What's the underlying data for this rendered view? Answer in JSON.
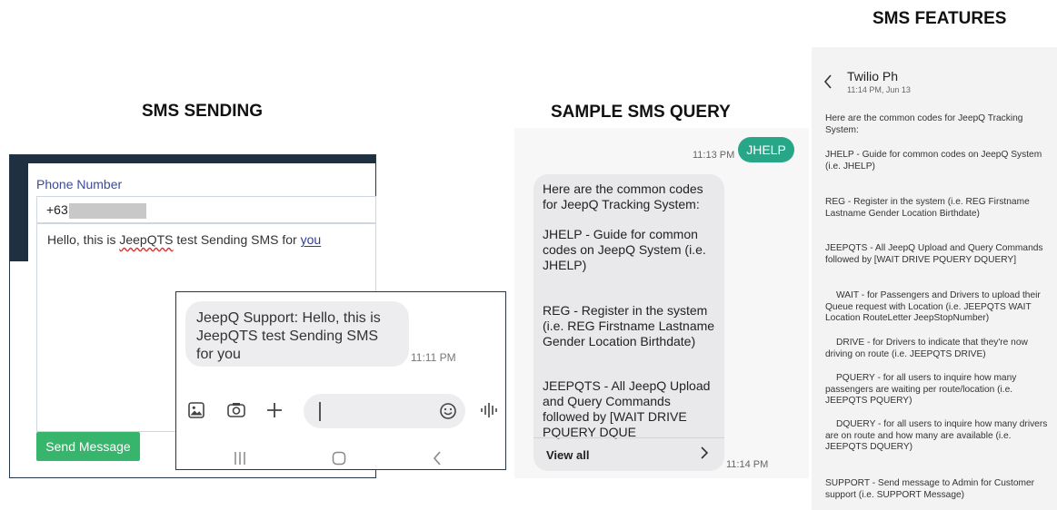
{
  "headings": {
    "sending": "SMS SENDING",
    "query": "SAMPLE SMS QUERY",
    "features": "SMS FEATURES"
  },
  "form": {
    "phone_label": "Phone Number",
    "phone_prefix": "+63",
    "message_part1": "Hello, this is ",
    "message_brand": "JeepQTS",
    "message_part2": " test Sending SMS for ",
    "message_you": "you",
    "send_button": "Send Message"
  },
  "chat": {
    "message": "JeepQ Support: Hello, this is JeepQTS test Sending SMS for you",
    "time": "11:11 PM",
    "icons": [
      "gallery-icon",
      "camera-icon",
      "plus-icon",
      "emoji-icon",
      "voice-icon"
    ],
    "navbar_icons": [
      "recent-apps-icon",
      "home-icon",
      "back-icon"
    ]
  },
  "query": {
    "sent_text": "JHELP",
    "sent_time": "11:13 PM",
    "reply_paragraphs": [
      "Here are the common codes for JeepQ Tracking System:",
      "JHELP - Guide for common codes on JeepQ System (i.e. JHELP)",
      "REG - Register in the system (i.e. REG Firstname Lastname Gender Location Birthdate)",
      "JEEPQTS - All JeepQ Upload and Query Commands followed by [WAIT DRIVE PQUERY DQUE"
    ],
    "view_all": "View all",
    "reply_time": "11:14 PM"
  },
  "features": {
    "contact": "Twilio Ph",
    "date": "11:14 PM, Jun 13",
    "items": [
      "Here are the common codes for JeepQ Tracking System:",
      "JHELP - Guide for common codes on JeepQ System (i.e. JHELP)",
      "REG - Register in the system (i.e. REG Firstname Lastname Gender Location Birthdate)",
      "JEEPQTS - All JeepQ Upload and Query Commands followed by [WAIT DRIVE PQUERY DQUERY]",
      "WAIT - for Passengers and Drivers to upload their Queue request with Location (i.e. JEEPQTS WAIT Location RouteLetter JeepStopNumber)",
      "DRIVE - for Drivers to indicate that they're now driving on route (i.e. JEEPQTS DRIVE)",
      "PQUERY - for all users to inquire how many passengers are waiting per route/location (i.e. JEEPQTS PQUERY)",
      "DQUERY - for all users to inquire how many drivers are on route and how many are available (i.e. JEEPQTS DQUERY)",
      "SUPPORT - Send message to Admin for Customer support (i.e. SUPPORT Message)"
    ]
  }
}
